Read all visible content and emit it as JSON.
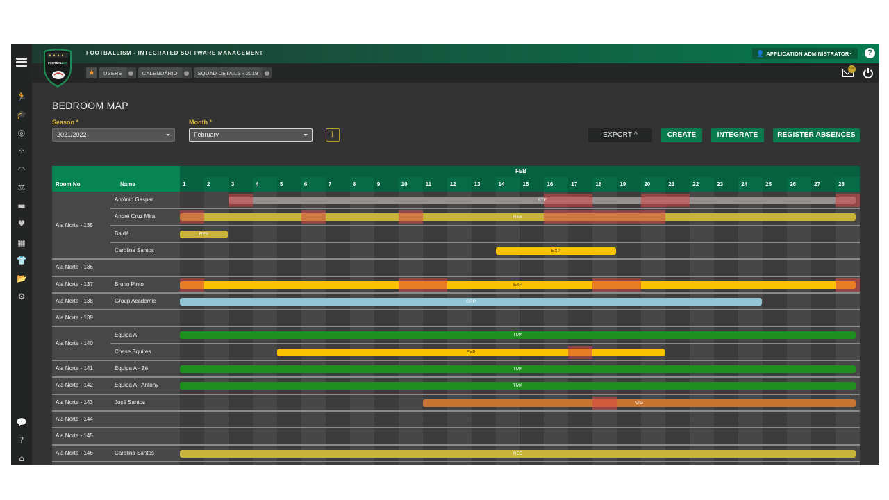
{
  "app": {
    "title": "FOOTBALLISM - INTEGRATED SOFTWARE MANAGEMENT",
    "logo_text": "FOOTBALL ISM",
    "user_label": "APPLICATION ADMINISTRATOR",
    "mail_count": "190",
    "colors": {
      "brand_green": "#0b7a4e",
      "header_dark_green": "#066140",
      "label_yellow": "#d6b43a"
    }
  },
  "tabs": [
    {
      "label": "USERS"
    },
    {
      "label": "CALENDÁRIO"
    },
    {
      "label": "SQUAD DETAILS - 2019"
    }
  ],
  "sidebar": {
    "items": [
      {
        "icon": "running-person-icon"
      },
      {
        "icon": "graduation-cap-icon"
      },
      {
        "icon": "target-icon"
      },
      {
        "icon": "tactics-dots-icon"
      },
      {
        "icon": "speedometer-icon"
      },
      {
        "icon": "scales-icon"
      },
      {
        "icon": "briefcase-icon"
      },
      {
        "icon": "heartbeat-icon"
      },
      {
        "icon": "field-icon"
      },
      {
        "icon": "shirt-icon"
      },
      {
        "icon": "folder-open-icon"
      },
      {
        "icon": "gears-icon"
      }
    ],
    "bottom_items": [
      {
        "icon": "chat-question-icon"
      },
      {
        "icon": "help-icon"
      },
      {
        "icon": "home-icon"
      }
    ]
  },
  "page": {
    "title": "BEDROOM MAP",
    "season_label": "Season *",
    "season_value": "2021/2022",
    "month_label": "Month *",
    "month_value": "February",
    "info_label": "i",
    "buttons": {
      "export": "EXPORT ^",
      "create": "CREATE",
      "integrate": "INTEGRATE",
      "register_absences": "REGISTER ABSENCES"
    }
  },
  "grid": {
    "month_label": "FEB",
    "col_room": "Room No",
    "col_name": "Name",
    "days": [
      "1",
      "2",
      "3",
      "4",
      "5",
      "6",
      "7",
      "8",
      "9",
      "10",
      "11",
      "12",
      "13",
      "14",
      "15",
      "16",
      "17",
      "18",
      "19",
      "20",
      "21",
      "22",
      "23",
      "24",
      "25",
      "26",
      "27",
      "28"
    ],
    "rooms": [
      {
        "room": "Ala Norte - 135",
        "occupants": [
          {
            "name": "António Gaspar",
            "bookings": [
              {
                "code": "STF",
                "start": 3,
                "end": 28,
                "color": "#958f8e",
                "text_color": "#f0f0f0",
                "conflicts": [
                  [
                    3,
                    3
                  ],
                  [
                    16,
                    17
                  ],
                  [
                    20,
                    21
                  ],
                  [
                    28,
                    28
                  ]
                ]
              }
            ]
          },
          {
            "name": "André Cruz Mira",
            "bookings": [
              {
                "code": "RES",
                "start": 1,
                "end": 28,
                "color": "#c8b43a",
                "text_color": "#ffffff",
                "conflicts": [
                  [
                    1,
                    1
                  ],
                  [
                    6,
                    6
                  ],
                  [
                    10,
                    10
                  ],
                  [
                    16,
                    20
                  ]
                ]
              }
            ]
          },
          {
            "name": "Baldé",
            "bookings": [
              {
                "code": "RES",
                "start": 1,
                "end": 2,
                "color": "#c8b43a",
                "text_color": "#ffffff",
                "conflicts": []
              }
            ]
          },
          {
            "name": "Carolina Santos",
            "bookings": [
              {
                "code": "EXP",
                "start": 14,
                "end": 18,
                "color": "#fcc400",
                "text_color": "#3a3000",
                "conflicts": []
              }
            ]
          }
        ]
      },
      {
        "room": "Ala Norte - 136",
        "occupants": [
          {
            "name": "",
            "bookings": []
          }
        ]
      },
      {
        "room": "Ala Norte - 137",
        "occupants": [
          {
            "name": "Bruno Pinto",
            "bookings": [
              {
                "code": "EXP",
                "start": 1,
                "end": 28,
                "color": "#fcc400",
                "text_color": "#3a3000",
                "conflicts": [
                  [
                    1,
                    1
                  ],
                  [
                    10,
                    11
                  ],
                  [
                    18,
                    19
                  ],
                  [
                    28,
                    28
                  ]
                ]
              }
            ]
          }
        ]
      },
      {
        "room": "Ala Norte - 138",
        "occupants": [
          {
            "name": "Group Academic",
            "bookings": [
              {
                "code": "GRP",
                "start": 1,
                "end": 24,
                "color": "#92c5d6",
                "text_color": "#f4f8fa",
                "conflicts": []
              }
            ]
          }
        ]
      },
      {
        "room": "Ala Norte - 139",
        "occupants": [
          {
            "name": "",
            "bookings": []
          }
        ]
      },
      {
        "room": "Ala Norte - 140",
        "occupants": [
          {
            "name": "Equipa A",
            "bookings": [
              {
                "code": "TMA",
                "start": 1,
                "end": 28,
                "color": "#1f8e1f",
                "text_color": "#ffffff",
                "conflicts": []
              }
            ]
          },
          {
            "name": "Chase Squires",
            "bookings": [
              {
                "code": "EXP",
                "start": 5,
                "end": 20,
                "color": "#fcc400",
                "text_color": "#3a3000",
                "conflicts": [
                  [
                    17,
                    17
                  ]
                ]
              }
            ]
          }
        ]
      },
      {
        "room": "Ala Norte - 141",
        "occupants": [
          {
            "name": "Equipa A - Zé",
            "bookings": [
              {
                "code": "TMA",
                "start": 1,
                "end": 28,
                "color": "#1f8e1f",
                "text_color": "#ffffff",
                "conflicts": []
              }
            ]
          }
        ]
      },
      {
        "room": "Ala Norte - 142",
        "occupants": [
          {
            "name": "Equipa A - Antony",
            "bookings": [
              {
                "code": "TMA",
                "start": 1,
                "end": 28,
                "color": "#1f8e1f",
                "text_color": "#ffffff",
                "conflicts": []
              }
            ]
          }
        ]
      },
      {
        "room": "Ala Norte - 143",
        "occupants": [
          {
            "name": "José Santos",
            "bookings": [
              {
                "code": "VIG",
                "start": 11,
                "end": 28,
                "color": "#c87532",
                "text_color": "#ffffff",
                "conflicts": [
                  [
                    18,
                    18
                  ]
                ]
              }
            ]
          }
        ]
      },
      {
        "room": "Ala Norte - 144",
        "occupants": [
          {
            "name": "",
            "bookings": []
          }
        ]
      },
      {
        "room": "Ala Norte - 145",
        "occupants": [
          {
            "name": "",
            "bookings": []
          }
        ]
      },
      {
        "room": "Ala Norte - 146",
        "occupants": [
          {
            "name": "Carolina Santos",
            "bookings": [
              {
                "code": "RES",
                "start": 1,
                "end": 28,
                "color": "#c8b43a",
                "text_color": "#ffffff",
                "conflicts": []
              }
            ]
          }
        ]
      }
    ]
  }
}
